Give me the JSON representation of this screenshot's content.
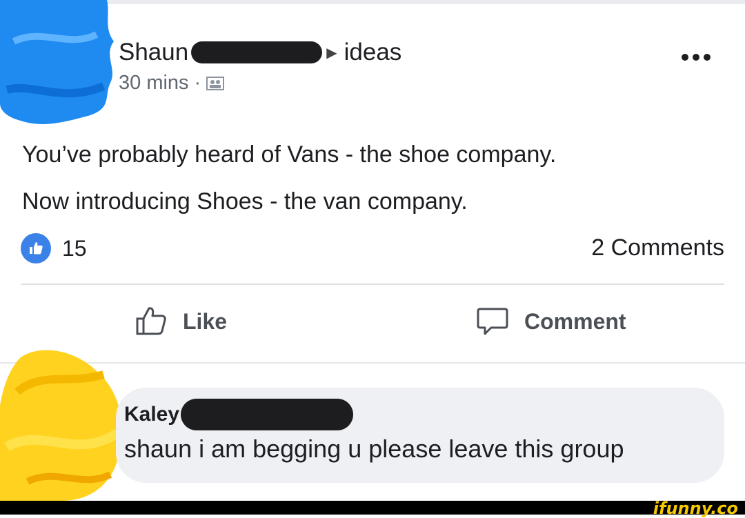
{
  "post": {
    "author": "Shaun",
    "arrow": "▶",
    "group": "ideas",
    "time": "30 mins",
    "separator": "·",
    "text_line1": "You’ve probably heard of Vans - the shoe company.",
    "text_line2": "Now introducing Shoes - the van company.",
    "like_count": "15",
    "comments_count": "2 Comments"
  },
  "actions": {
    "like_label": "Like",
    "comment_label": "Comment"
  },
  "comment": {
    "author": "Kaley",
    "text": "shaun i am begging u please leave this group"
  },
  "watermark": "ifunny.co",
  "icons": {
    "more": "more-horizontal-icon",
    "privacy": "group-members-icon",
    "like_badge": "thumbs-up-icon",
    "like_action": "thumbs-up-outline-icon",
    "comment_action": "speech-bubble-icon"
  },
  "colors": {
    "like_blue": "#3b82e8",
    "text": "#1c1e21",
    "secondary_text": "#606770",
    "bubble": "#eff0f3",
    "watermark": "#f5c800"
  }
}
